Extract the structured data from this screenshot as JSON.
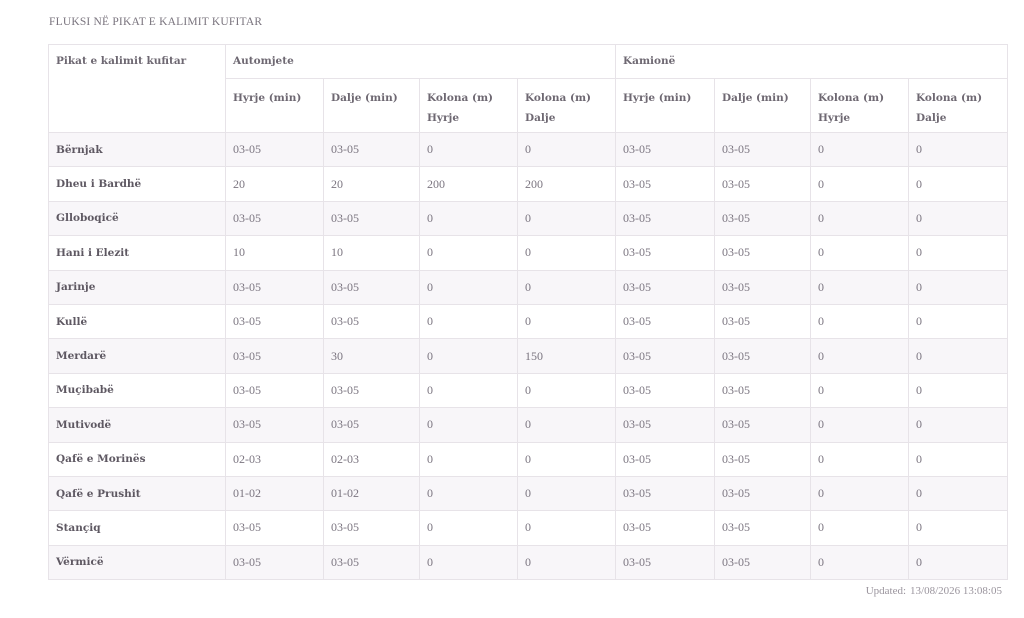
{
  "title": "FLUKSI NË PIKAT E KALIMIT KUFITAR",
  "table": {
    "row_header": "Pikat e kalimit kufitar",
    "groups": [
      "Automjete",
      "Kamionë"
    ],
    "sub_headers": [
      "Hyrje (min)",
      "Dalje (min)",
      "Kolona (m) Hyrje",
      "Kolona (m) Dalje",
      "Hyrje (min)",
      "Dalje (min)",
      "Kolona (m) Hyrje",
      "Kolona (m) Dalje"
    ],
    "rows": [
      {
        "name": "Bërnjak",
        "values": [
          "03-05",
          "03-05",
          "0",
          "0",
          "03-05",
          "03-05",
          "0",
          "0"
        ]
      },
      {
        "name": "Dheu i Bardhë",
        "values": [
          "20",
          "20",
          "200",
          "200",
          "03-05",
          "03-05",
          "0",
          "0"
        ]
      },
      {
        "name": "Glloboqicë",
        "values": [
          "03-05",
          "03-05",
          "0",
          "0",
          "03-05",
          "03-05",
          "0",
          "0"
        ]
      },
      {
        "name": "Hani i Elezit",
        "values": [
          "10",
          "10",
          "0",
          "0",
          "03-05",
          "03-05",
          "0",
          "0"
        ]
      },
      {
        "name": "Jarinje",
        "values": [
          "03-05",
          "03-05",
          "0",
          "0",
          "03-05",
          "03-05",
          "0",
          "0"
        ]
      },
      {
        "name": "Kullë",
        "values": [
          "03-05",
          "03-05",
          "0",
          "0",
          "03-05",
          "03-05",
          "0",
          "0"
        ]
      },
      {
        "name": "Merdarë",
        "values": [
          "03-05",
          "30",
          "0",
          "150",
          "03-05",
          "03-05",
          "0",
          "0"
        ]
      },
      {
        "name": "Muçibabë",
        "values": [
          "03-05",
          "03-05",
          "0",
          "0",
          "03-05",
          "03-05",
          "0",
          "0"
        ]
      },
      {
        "name": "Mutivodë",
        "values": [
          "03-05",
          "03-05",
          "0",
          "0",
          "03-05",
          "03-05",
          "0",
          "0"
        ]
      },
      {
        "name": "Qafë e Morinës",
        "values": [
          "02-03",
          "02-03",
          "0",
          "0",
          "03-05",
          "03-05",
          "0",
          "0"
        ]
      },
      {
        "name": "Qafë e Prushit",
        "values": [
          "01-02",
          "01-02",
          "0",
          "0",
          "03-05",
          "03-05",
          "0",
          "0"
        ]
      },
      {
        "name": "Stançiq",
        "values": [
          "03-05",
          "03-05",
          "0",
          "0",
          "03-05",
          "03-05",
          "0",
          "0"
        ]
      },
      {
        "name": "Vërmicë",
        "values": [
          "03-05",
          "03-05",
          "0",
          "0",
          "03-05",
          "03-05",
          "0",
          "0"
        ]
      }
    ]
  },
  "updated": {
    "label": "Updated:",
    "value": "13/08/2026 13:08:05"
  }
}
